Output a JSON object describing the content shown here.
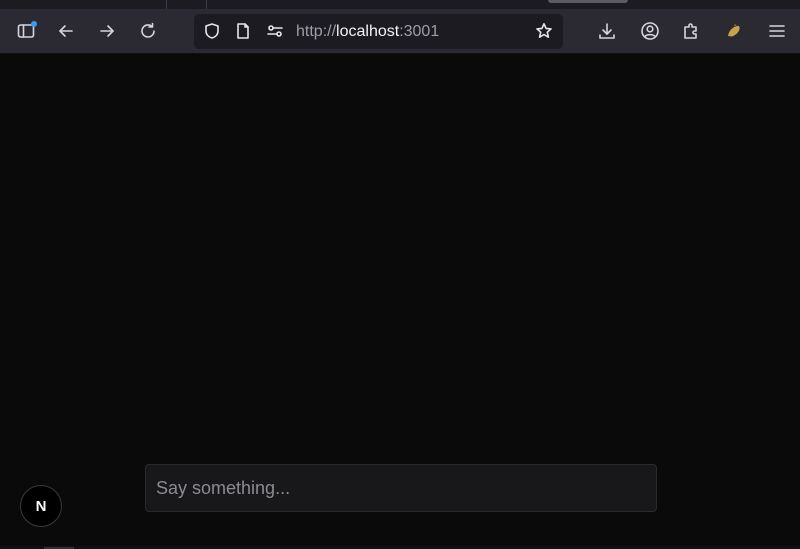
{
  "browser": {
    "toolbar": {
      "sidebar_icon": "sidebar-icon",
      "back_icon": "arrow-left-icon",
      "forward_icon": "arrow-right-icon",
      "reload_icon": "reload-icon",
      "shield_icon": "shield-icon",
      "page_icon": "page-icon",
      "permissions_icon": "permissions-icon",
      "bookmark_icon": "star-icon",
      "downloads_icon": "download-icon",
      "account_icon": "account-icon",
      "extensions_icon": "puzzle-icon",
      "extension_item_icon": "extension-item-icon",
      "menu_icon": "hamburger-icon"
    },
    "address_bar": {
      "scheme": "http://",
      "host": "localhost",
      "port": ":3001"
    }
  },
  "page": {
    "chat_input": {
      "value": "",
      "placeholder": "Say something..."
    },
    "dev_badge": {
      "letter": "N"
    }
  },
  "colors": {
    "page_background": "#0a0a0a",
    "toolbar_background": "#2b2a33",
    "urlbar_background": "#1c1b22",
    "input_background": "#18181b",
    "notification_dot": "#3b9bf0"
  }
}
